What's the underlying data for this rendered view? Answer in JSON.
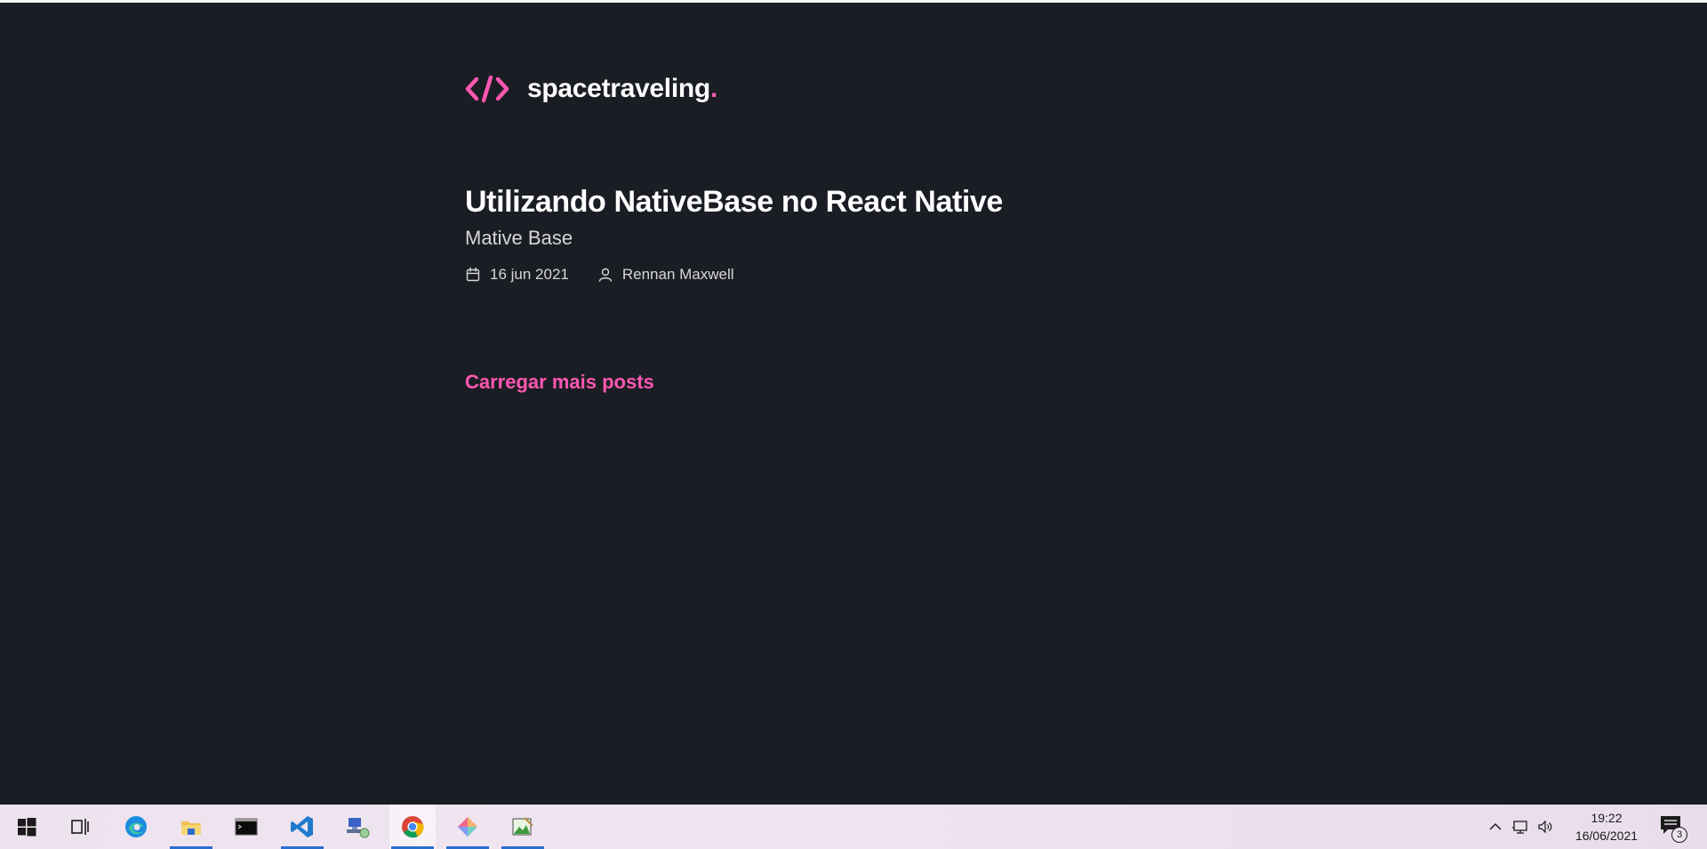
{
  "site": {
    "brand_name": "spacetraveling",
    "brand_dot": ".",
    "accent_color": "#FF57B2",
    "background_color": "#1A1D23"
  },
  "post": {
    "title": "Utilizando NativeBase no React Native",
    "subtitle": "Mative Base",
    "date": "16 jun 2021",
    "author": "Rennan Maxwell",
    "date_icon": "calendar-icon",
    "author_icon": "user-icon"
  },
  "load_more_label": "Carregar mais posts",
  "taskbar": {
    "apps": [
      {
        "name": "start-icon"
      },
      {
        "name": "task-view-icon"
      },
      {
        "name": "edge-icon"
      },
      {
        "name": "file-explorer-icon"
      },
      {
        "name": "terminal-icon"
      },
      {
        "name": "vscode-icon"
      },
      {
        "name": "network-drive-icon"
      },
      {
        "name": "chrome-icon"
      },
      {
        "name": "git-client-icon"
      },
      {
        "name": "image-app-icon"
      }
    ],
    "clock": {
      "time": "19:22",
      "date": "16/06/2021"
    },
    "notification_count": "3"
  }
}
